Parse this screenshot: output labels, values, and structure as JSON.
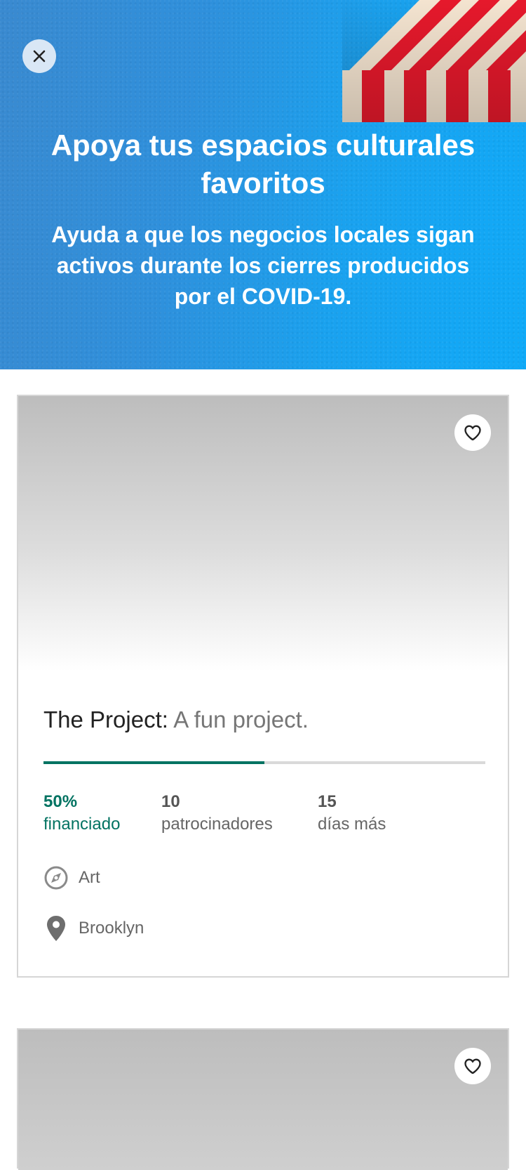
{
  "header": {
    "title": "Apoya tus espacios culturales favoritos",
    "subtitle": "Ayuda a que los negocios locales sigan activos durante los cierres producidos por el COVID-19."
  },
  "project": {
    "name": "The Project:",
    "blurb": "A fun project.",
    "funded_percent": 0.5,
    "stats": {
      "funded_value": "50%",
      "funded_label": "financiado",
      "backers_value": "10",
      "backers_label": "patrocinadores",
      "days_value": "15",
      "days_label": "días más"
    },
    "category": "Art",
    "location": "Brooklyn"
  },
  "colors": {
    "header_blue": "#2f90dc",
    "funded_green": "#037362"
  },
  "icons": {
    "close": "close-icon",
    "heart": "heart-icon",
    "category": "compass-icon",
    "location": "map-pin-icon"
  }
}
